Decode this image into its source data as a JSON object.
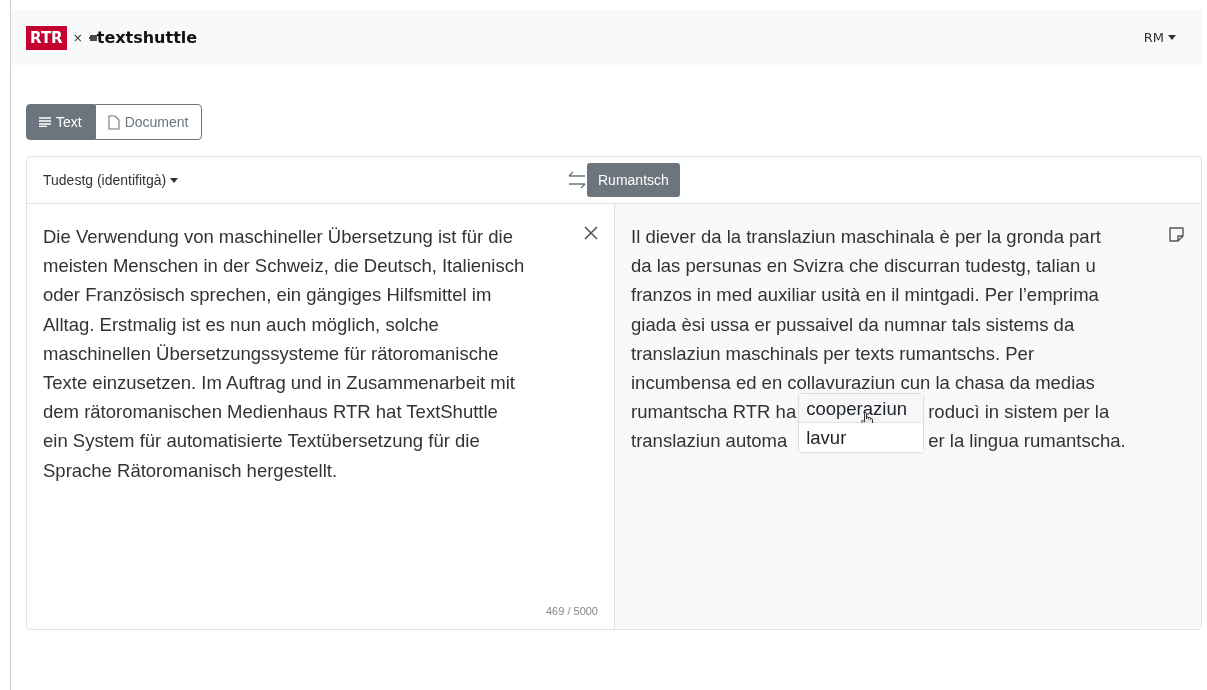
{
  "header": {
    "logo_left": "RTR",
    "separator": "×",
    "logo_right": "textshuttle",
    "language_menu": "RM"
  },
  "mode_tabs": [
    {
      "label": "Text",
      "selected": true
    },
    {
      "label": "Document",
      "selected": false
    }
  ],
  "translator": {
    "source_language": "Tudestg (identifitgà)",
    "target_languages": [
      {
        "label": "Rumantsch",
        "selected": true
      }
    ],
    "input_lines": [
      "Die Verwendung von maschineller Übersetzung ist für die",
      "meisten Menschen in der Schweiz, die Deutsch, Italienisch",
      "oder Französisch sprechen, ein gängiges Hilfsmittel im",
      "Alltag. Erstmalig ist es nun auch möglich, solche",
      "maschinellen Übersetzungssysteme für rätoromanische",
      "Texte einzusetzen. Im Auftrag und in Zusammenarbeit mit",
      "dem rätoromanischen Medienhaus RTR hat TextShuttle",
      "ein System für automatisierte Textübersetzung für die",
      "Sprache Rätoromanisch hergestellt."
    ],
    "char_count": "469 / 5000",
    "output_lines": [
      {
        "parts": [
          "Il diever da la translaziun maschinala è per la gronda part"
        ]
      },
      {
        "parts": [
          "da las persunas en Svizra che discurran tudestg, talian u"
        ]
      },
      {
        "parts": [
          "franzos in med auxiliar usità en il mintgadi. Per l’emprima"
        ]
      },
      {
        "parts": [
          "giada èsi ussa er pussaivel da numnar tals sistems da"
        ]
      },
      {
        "parts": [
          "translaziun maschinals per texts rumantschs. Per"
        ]
      },
      {
        "parts": [
          "incumbensa ed en collavuraziun cun la chasa da medias"
        ]
      },
      {
        "parts": [
          "rumantscha RTR ha",
          "roducì in sistem per la"
        ]
      },
      {
        "parts": [
          "translaziun automa",
          "er la lingua rumantscha."
        ]
      }
    ],
    "alternatives": [
      {
        "label": "cooperaziun",
        "selected": true
      },
      {
        "label": "lavur",
        "selected": false
      }
    ]
  }
}
